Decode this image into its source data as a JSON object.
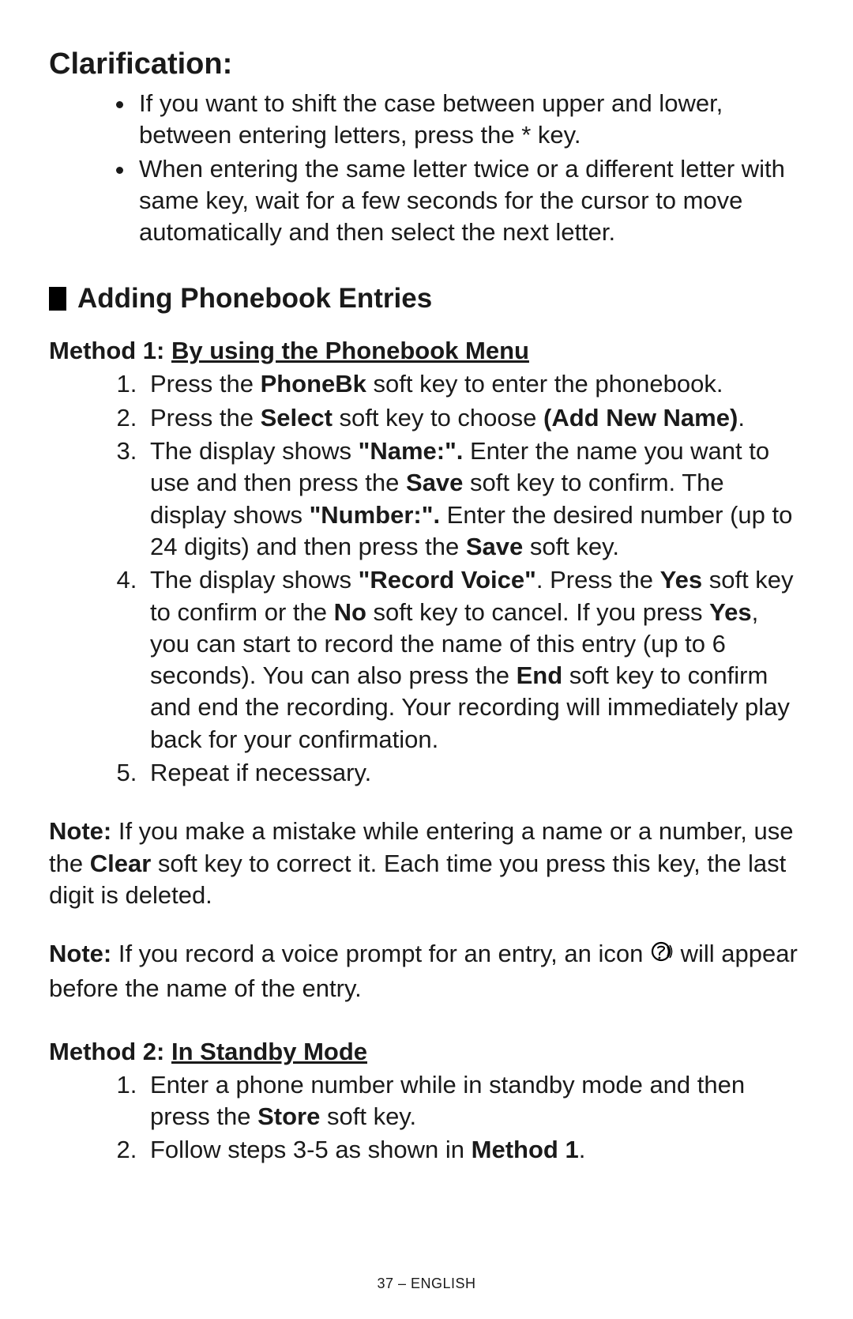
{
  "clarification": {
    "heading": "Clarification:",
    "bullets": [
      "If you want to shift the case between upper and lower, between entering letters, press the * key.",
      "When entering the same letter twice or a different letter with same key, wait for a few seconds for the cursor to move automatically and then select the next letter."
    ]
  },
  "section_title": "Adding Phonebook Entries",
  "method1": {
    "label_prefix": "Method 1: ",
    "label_underline": "By using the Phonebook Menu",
    "steps": {
      "s1_a": "Press the ",
      "s1_b": "PhoneBk",
      "s1_c": " soft key to enter the phonebook.",
      "s2_a": "Press the ",
      "s2_b": "Select",
      "s2_c": " soft key to choose ",
      "s2_d": "(Add New Name)",
      "s2_e": ".",
      "s3_a": "The display shows ",
      "s3_b": "\"Name:\".",
      "s3_c": " Enter the name you want to use and then press the ",
      "s3_d": "Save",
      "s3_e": " soft key to confirm. The display shows ",
      "s3_f": "\"Number:\".",
      "s3_g": "  Enter the desired number (up to 24 digits) and then press the ",
      "s3_h": "Save",
      "s3_i": " soft key.",
      "s4_a": "The display shows ",
      "s4_b": "\"Record Voice\"",
      "s4_c": ". Press the ",
      "s4_d": "Yes",
      "s4_e": " soft key to confirm or the ",
      "s4_f": "No",
      "s4_g": " soft key to cancel.  If you press ",
      "s4_h": "Yes",
      "s4_i": ", you can start to record the name of this entry (up to 6 seconds).  You can also press the ",
      "s4_j": "End",
      "s4_k": " soft key to confirm and end the recording.  Your recording will immediately play back for your confirmation.",
      "s5": "Repeat if necessary."
    }
  },
  "note1": {
    "label": "Note:",
    "a": " If you make a mistake while entering a name or a number, use the ",
    "b": "Clear",
    "c": " soft key to correct it.  Each time you press this key, the last digit is deleted."
  },
  "note2": {
    "label": "Note:",
    "a": " If you record a voice prompt for an entry, an icon ",
    "b": " will appear before the name of the entry."
  },
  "method2": {
    "label_prefix": "Method 2: ",
    "label_underline": "In Standby Mode",
    "steps": {
      "s1_a": "Enter a phone number while in standby mode and then press the ",
      "s1_b": "Store",
      "s1_c": " soft key.",
      "s2_a": "Follow steps 3-5 as shown in ",
      "s2_b": "Method 1",
      "s2_c": "."
    }
  },
  "footer": "37 – ENGLISH"
}
